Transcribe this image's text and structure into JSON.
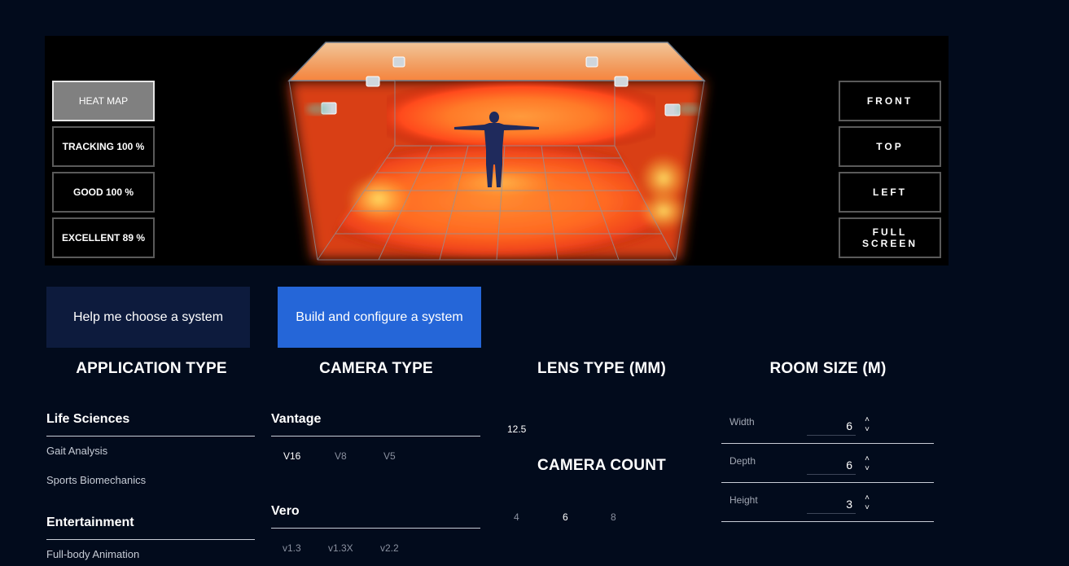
{
  "viewer": {
    "left_buttons": [
      {
        "label": "HEAT MAP",
        "active": true
      },
      {
        "label": "TRACKING 100 %",
        "active": false
      },
      {
        "label": "GOOD 100 %",
        "active": false
      },
      {
        "label": "EXCELLENT 89 %",
        "active": false
      }
    ],
    "right_buttons": [
      {
        "label": "FRONT"
      },
      {
        "label": "TOP"
      },
      {
        "label": "LEFT"
      },
      {
        "label": "FULL\nSCREEN"
      }
    ]
  },
  "modes": {
    "help_label": "Help me choose a system",
    "build_label": "Build and configure a system",
    "active": "build"
  },
  "application_type": {
    "title": "APPLICATION TYPE",
    "groups": [
      {
        "name": "Life Sciences",
        "items": [
          "Gait Analysis",
          "Sports Biomechanics"
        ]
      },
      {
        "name": "Entertainment",
        "items": [
          "Full-body Animation"
        ]
      }
    ]
  },
  "camera_type": {
    "title": "CAMERA TYPE",
    "groups": [
      {
        "name": "Vantage",
        "options": [
          "V16",
          "V8",
          "V5"
        ],
        "selected": "V16"
      },
      {
        "name": "Vero",
        "options": [
          "v1.3",
          "v1.3X",
          "v2.2"
        ],
        "selected": ""
      }
    ]
  },
  "lens_type": {
    "title": "LENS TYPE (MM)",
    "options": [
      "12.5"
    ],
    "selected": "12.5"
  },
  "camera_count": {
    "title": "CAMERA COUNT",
    "options": [
      "4",
      "6",
      "8"
    ],
    "selected": "6"
  },
  "room_size": {
    "title": "ROOM SIZE (M)",
    "fields": [
      {
        "label": "Width",
        "value": "6"
      },
      {
        "label": "Depth",
        "value": "6"
      },
      {
        "label": "Height",
        "value": "3"
      }
    ],
    "spinner_up": "˄",
    "spinner_down": "˅"
  }
}
